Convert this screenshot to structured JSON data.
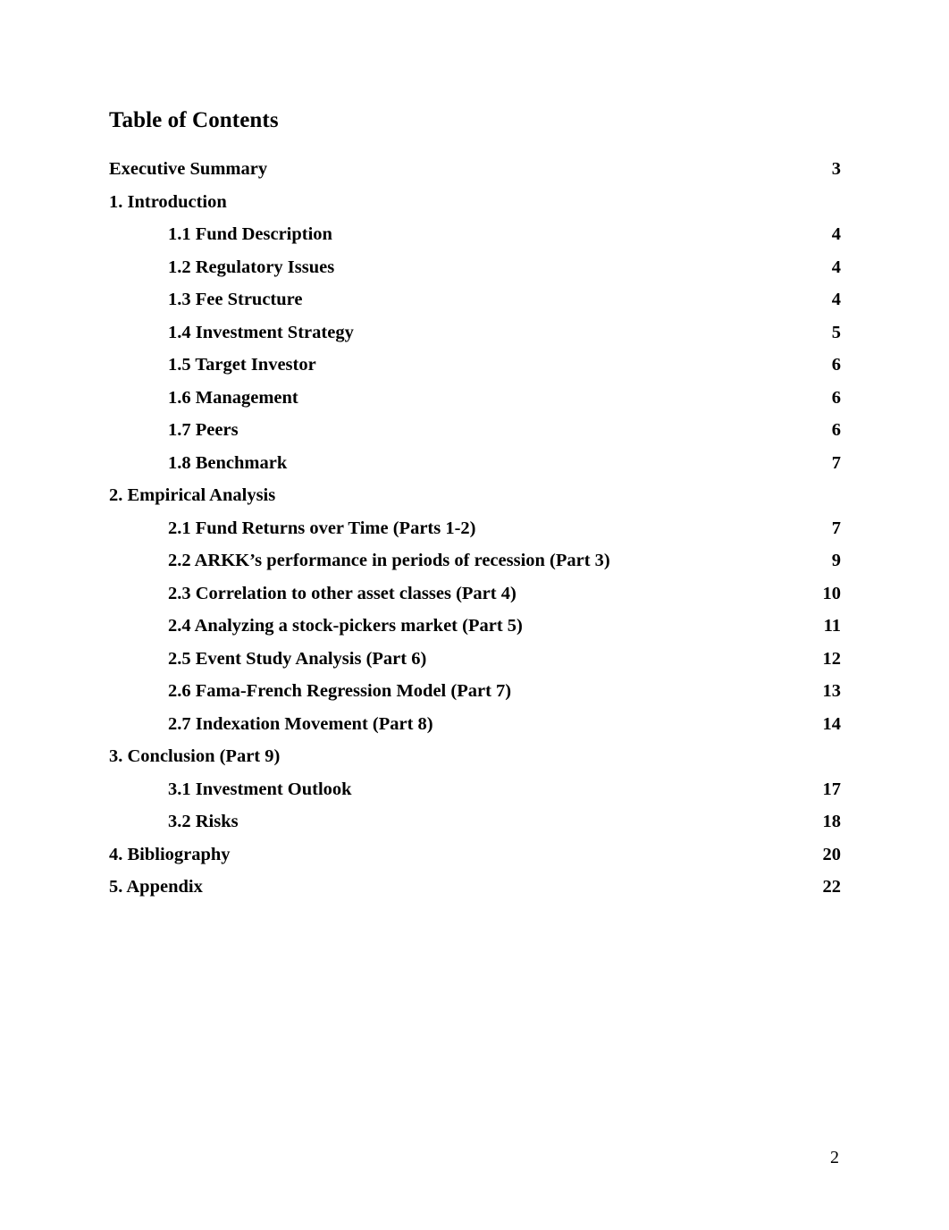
{
  "document": {
    "heading": "Table of Contents",
    "footer_page_number": "2"
  },
  "toc": {
    "entries": [
      {
        "label": "Executive Summary",
        "page": "3",
        "level": 1
      },
      {
        "label": "1. Introduction",
        "page": "",
        "level": 1
      },
      {
        "label": "1.1 Fund Description",
        "page": "4",
        "level": 2
      },
      {
        "label": "1.2 Regulatory Issues",
        "page": "4",
        "level": 2
      },
      {
        "label": "1.3 Fee Structure",
        "page": "4",
        "level": 2
      },
      {
        "label": "1.4 Investment Strategy",
        "page": "5",
        "level": 2
      },
      {
        "label": "1.5 Target Investor",
        "page": "6",
        "level": 2
      },
      {
        "label": "1.6 Management",
        "page": "6",
        "level": 2
      },
      {
        "label": "1.7 Peers",
        "page": "6",
        "level": 2
      },
      {
        "label": "1.8 Benchmark",
        "page": "7",
        "level": 2
      },
      {
        "label": "2. Empirical Analysis",
        "page": "",
        "level": 1
      },
      {
        "label": "2.1 Fund Returns over Time (Parts 1-2)",
        "page": "7",
        "level": 2
      },
      {
        "label": "2.2 ARKK’s performance in periods of recession (Part 3)",
        "page": "9",
        "level": 2
      },
      {
        "label": "2.3 Correlation to other asset classes (Part 4)",
        "page": "10",
        "level": 2
      },
      {
        "label": "2.4 Analyzing a stock-pickers market (Part 5)",
        "page": "11",
        "level": 2
      },
      {
        "label": "2.5 Event Study Analysis (Part 6)",
        "page": "12",
        "level": 2
      },
      {
        "label": "2.6 Fama-French Regression Model (Part 7)",
        "page": "13",
        "level": 2
      },
      {
        "label": "2.7 Indexation Movement (Part 8)",
        "page": "14",
        "level": 2
      },
      {
        "label": "3. Conclusion (Part 9)",
        "page": "",
        "level": 1
      },
      {
        "label": "3.1 Investment Outlook",
        "page": "17",
        "level": 2
      },
      {
        "label": "3.2 Risks",
        "page": "18",
        "level": 2
      },
      {
        "label": "4. Bibliography",
        "page": "20",
        "level": 1
      },
      {
        "label": "5. Appendix",
        "page": "22",
        "level": 1
      }
    ]
  }
}
